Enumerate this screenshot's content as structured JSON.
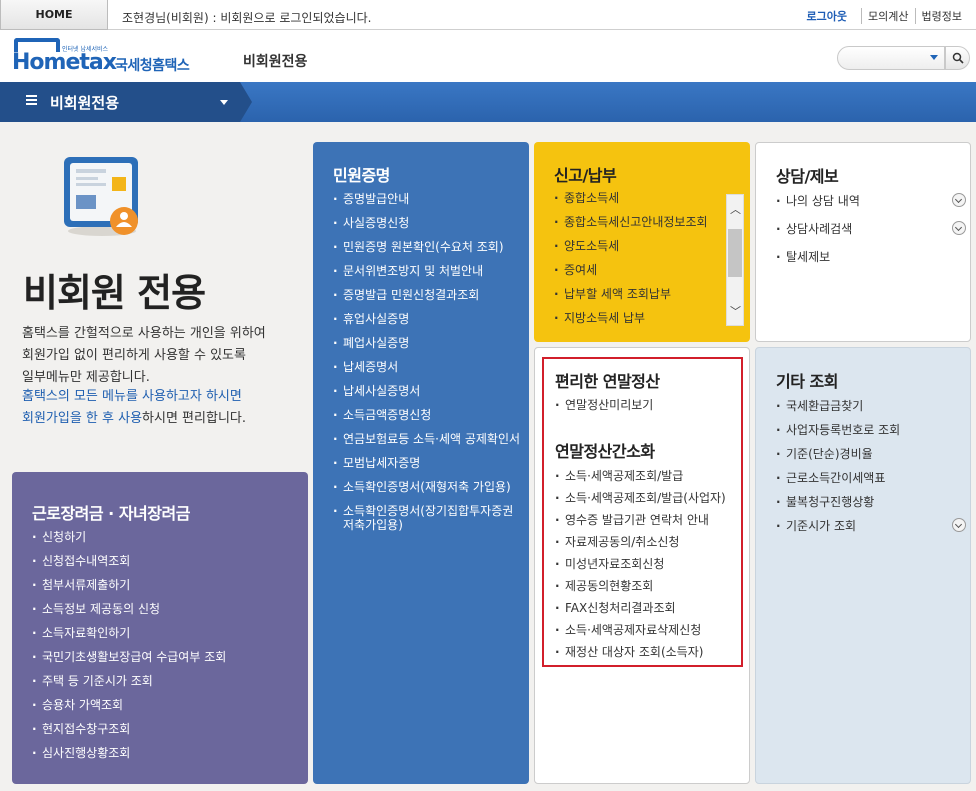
{
  "topbar": {
    "home": "HOME",
    "login_message": "조현경님(비회원) : 비회원으로 로그인되었습니다.",
    "links": [
      "로그아웃",
      "모의계산",
      "법령정보"
    ]
  },
  "header": {
    "logo_tagline": "인터넷 납세서비스",
    "logo_text": "Hometax",
    "logo_kr": "국세청홈택스",
    "section_title": "비회원전용",
    "search_placeholder": ""
  },
  "nav": {
    "label": "비회원전용"
  },
  "intro": {
    "title": "비회원 전용",
    "desc_lines": [
      "홈택스를 간헐적으로 사용하는 개인을 위하여",
      "회원가입 없이 편리하게 사용할 수 있도록",
      "일부메뉴만 제공합니다."
    ],
    "link_line1": "홈택스의 모든 메뉴를 사용하고자 하시면",
    "link_line2_hl": "회원가입을 한 후 사용",
    "link_line2_rest": "하시면 편리합니다."
  },
  "panel_labor": {
    "title": "근로장려금 · 자녀장려금",
    "items": [
      "신청하기",
      "신청접수내역조회",
      "첨부서류제출하기",
      "소득정보 제공동의 신청",
      "소득자료확인하기",
      "국민기초생활보장급여 수급여부 조회",
      "주택 등 기준시가 조회",
      "승용차 가액조회",
      "현지접수창구조회",
      "심사진행상황조회"
    ]
  },
  "panel_civil": {
    "title": "민원증명",
    "items": [
      "증명발급안내",
      "사실증명신청",
      "민원증명 원본확인(수요처 조회)",
      "문서위변조방지 및 처벌안내",
      "증명발급 민원신청결과조회",
      "휴업사실증명",
      "폐업사실증명",
      "납세증명서",
      "납세사실증명서",
      "소득금액증명신청",
      "연금보험료등 소득·세액 공제확인서",
      "모범납세자증명",
      "소득확인증명서(재형저축 가입용)",
      "소득확인증명서(장기집합투자증권저축가입용)"
    ]
  },
  "panel_report": {
    "title": "신고/납부",
    "items": [
      "종합소득세",
      "종합소득세신고안내정보조회",
      "양도소득세",
      "증여세",
      "납부할 세액 조회납부",
      "지방소득세 납부"
    ]
  },
  "panel_consult": {
    "title": "상담/제보",
    "items": [
      "나의 상담 내역",
      "상담사례검색",
      "탈세제보"
    ]
  },
  "panel_yearend": {
    "title_a": "편리한 연말정산",
    "items_a": [
      "연말정산미리보기"
    ],
    "title_b": "연말정산간소화",
    "items_b": [
      "소득·세액공제조회/발급",
      "소득·세액공제조회/발급(사업자)",
      "영수증 발급기관 연락처 안내",
      "자료제공동의/취소신청",
      "미성년자료조회신청",
      "제공동의현황조회",
      "FAX신청처리결과조회",
      "소득·세액공제자료삭제신청",
      "재정산 대상자 조회(소득자)"
    ]
  },
  "panel_etc": {
    "title": "기타 조회",
    "items": [
      "국세환급금찾기",
      "사업자등록번호로 조회",
      "기준(단순)경비율",
      "근로소득간이세액표",
      "불복청구진행상황",
      "기준시가 조회"
    ]
  },
  "colors": {
    "primary_blue": "#3d73b6",
    "nav_blue": "#2b63ad",
    "yellow": "#f5c30f",
    "purple": "#6b679c",
    "highlight_red": "#d21f2b"
  }
}
